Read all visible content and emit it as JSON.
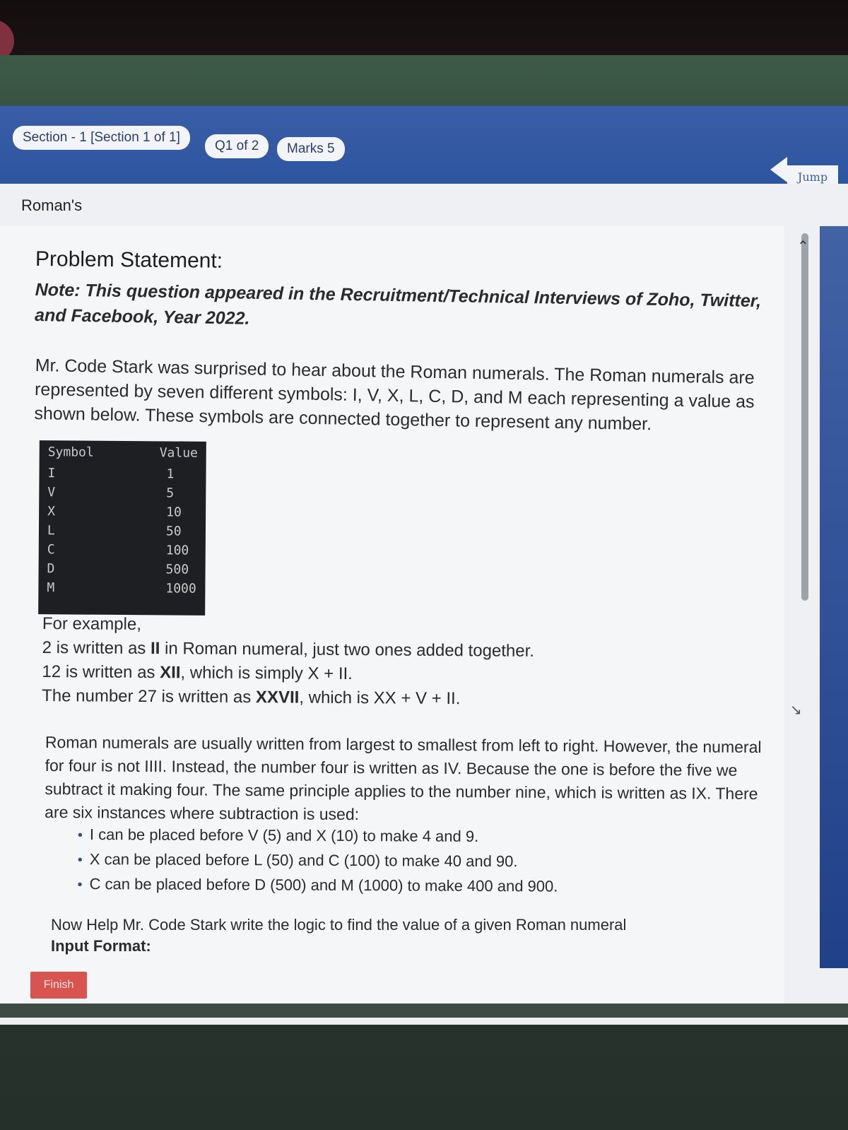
{
  "header": {
    "section_label": "Section - 1 [Section 1 of 1]",
    "question_label": "Q1 of 2",
    "marks_label": "Marks 5",
    "jump_label": "Jump"
  },
  "page": {
    "title": "Roman's"
  },
  "problem": {
    "heading": "Problem Statement:",
    "note": "Note: This question appeared in the Recruitment/Technical Interviews of Zoho, Twitter, and Facebook, Year 2022.",
    "intro": "Mr. Code Stark was surprised to hear about the Roman numerals. The Roman numerals are represented by seven different symbols: I, V, X, L, C, D, and M each representing a value as shown below. These symbols are connected together to represent any number.",
    "table": {
      "headers": [
        "Symbol",
        "Value"
      ],
      "rows": [
        [
          "I",
          "1"
        ],
        [
          "V",
          "5"
        ],
        [
          "X",
          "10"
        ],
        [
          "L",
          "50"
        ],
        [
          "C",
          "100"
        ],
        [
          "D",
          "500"
        ],
        [
          "M",
          "1000"
        ]
      ]
    },
    "example_heading": "For example,",
    "examples": [
      {
        "pre": "2 is written as ",
        "bold": "II",
        "post": " in Roman numeral, just two ones added together."
      },
      {
        "pre": "12 is written as ",
        "bold": "XII",
        "post": ", which is simply X + II."
      },
      {
        "pre": "The number 27 is written as ",
        "bold": "XXVII",
        "post": ", which is XX + V + II."
      }
    ],
    "rules_intro": "Roman numerals are usually written from largest to smallest from left to right. However, the numeral for four is not IIII. Instead, the number four is written as IV. Because the one is before the five we subtract it making four. The same principle applies to the number nine, which is written as IX. There are six instances where subtraction is used:",
    "bullets": [
      "I can be placed before V (5) and X (10) to make 4 and 9.",
      "X can be placed before L (50) and C (100) to make 40 and 90.",
      "C can be placed before D (500) and M (1000) to make 400 and 900."
    ],
    "task": "Now Help Mr. Code Stark write the logic to find the value of a given Roman numeral",
    "input_format": "Input Format:"
  },
  "footer": {
    "finish_label": "Finish"
  },
  "colors": {
    "header_blue": "#2d55a0",
    "finish_red": "#d9534f",
    "code_bg": "#1e1f22"
  }
}
